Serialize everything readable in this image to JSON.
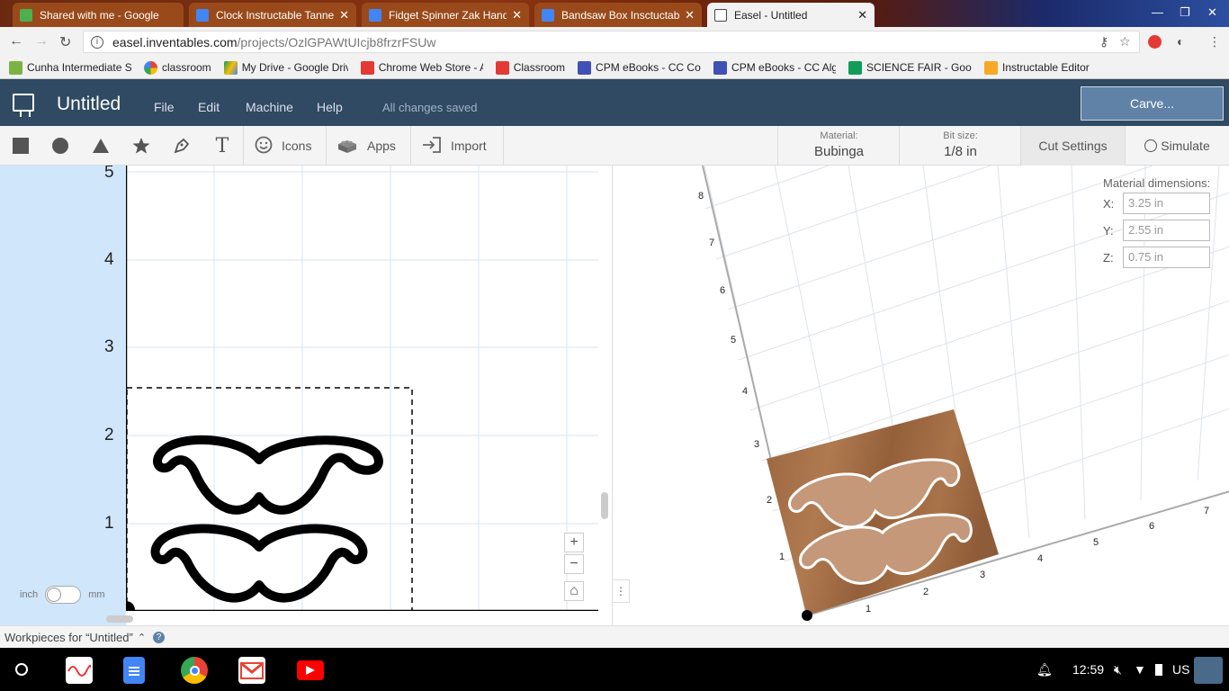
{
  "browser": {
    "tabs": [
      {
        "title": "Shared with me - Google",
        "color": "#4caf50"
      },
      {
        "title": "Clock Instructable Tanne",
        "color": "#4285f4"
      },
      {
        "title": "Fidget Spinner Zak Hand",
        "color": "#4285f4"
      },
      {
        "title": "Bandsaw Box Insctuctabl",
        "color": "#4285f4"
      },
      {
        "title": "Easel - Untitled",
        "color": "#ffffff",
        "active": true
      }
    ],
    "url_host": "easel.inventables.com",
    "url_path": "/projects/OzlGPAWtUIcjb8frzrFSUw",
    "bookmarks": [
      {
        "label": "Cunha Intermediate S",
        "color": "#7cb342"
      },
      {
        "label": "classroom",
        "color": "#ea4335"
      },
      {
        "label": "My Drive - Google Driv",
        "color": "#fbbc04"
      },
      {
        "label": "Chrome Web Store - A",
        "color": "#e53935"
      },
      {
        "label": "Classroom",
        "color": "#e53935"
      },
      {
        "label": "CPM eBooks - CC Cou",
        "color": "#3f51b5"
      },
      {
        "label": "CPM eBooks - CC Alg",
        "color": "#3f51b5"
      },
      {
        "label": "SCIENCE FAIR - Goog",
        "color": "#0f9d58"
      },
      {
        "label": "Instructable Editor",
        "color": "#f9a825"
      }
    ]
  },
  "app": {
    "title": "Untitled",
    "menu": [
      "File",
      "Edit",
      "Machine",
      "Help"
    ],
    "status": "All changes saved",
    "carve_label": "Carve..."
  },
  "tools": {
    "icons_label": "Icons",
    "apps_label": "Apps",
    "import_label": "Import",
    "material_label": "Material:",
    "material_value": "Bubinga",
    "bit_label": "Bit size:",
    "bit_value": "1/8 in",
    "cut_settings_label": "Cut Settings",
    "simulate_label": "Simulate"
  },
  "canvas": {
    "y_labels": [
      "5",
      "4",
      "3",
      "2",
      "1"
    ],
    "unit_left": "inch",
    "unit_right": "mm",
    "zoom_in": "+",
    "zoom_out": "−",
    "home": "⌂"
  },
  "preview": {
    "material_dimensions_label": "Material dimensions:",
    "x_label": "X:",
    "x_value": "3.25 in",
    "y_label": "Y:",
    "y_value": "2.55 in",
    "z_label": "Z:",
    "z_value": "0.75 in",
    "y_axis_labels": [
      "8",
      "7",
      "6",
      "5",
      "4",
      "3",
      "2",
      "1"
    ],
    "x_axis_labels": [
      "1",
      "2",
      "3",
      "4",
      "5",
      "6",
      "7"
    ],
    "wood_color": "#a0704a"
  },
  "workpieces": {
    "label": "Workpieces for “Untitled”",
    "chevron": "⌃",
    "help": "?"
  },
  "shelf": {
    "time": "12:59",
    "locale": "US"
  }
}
